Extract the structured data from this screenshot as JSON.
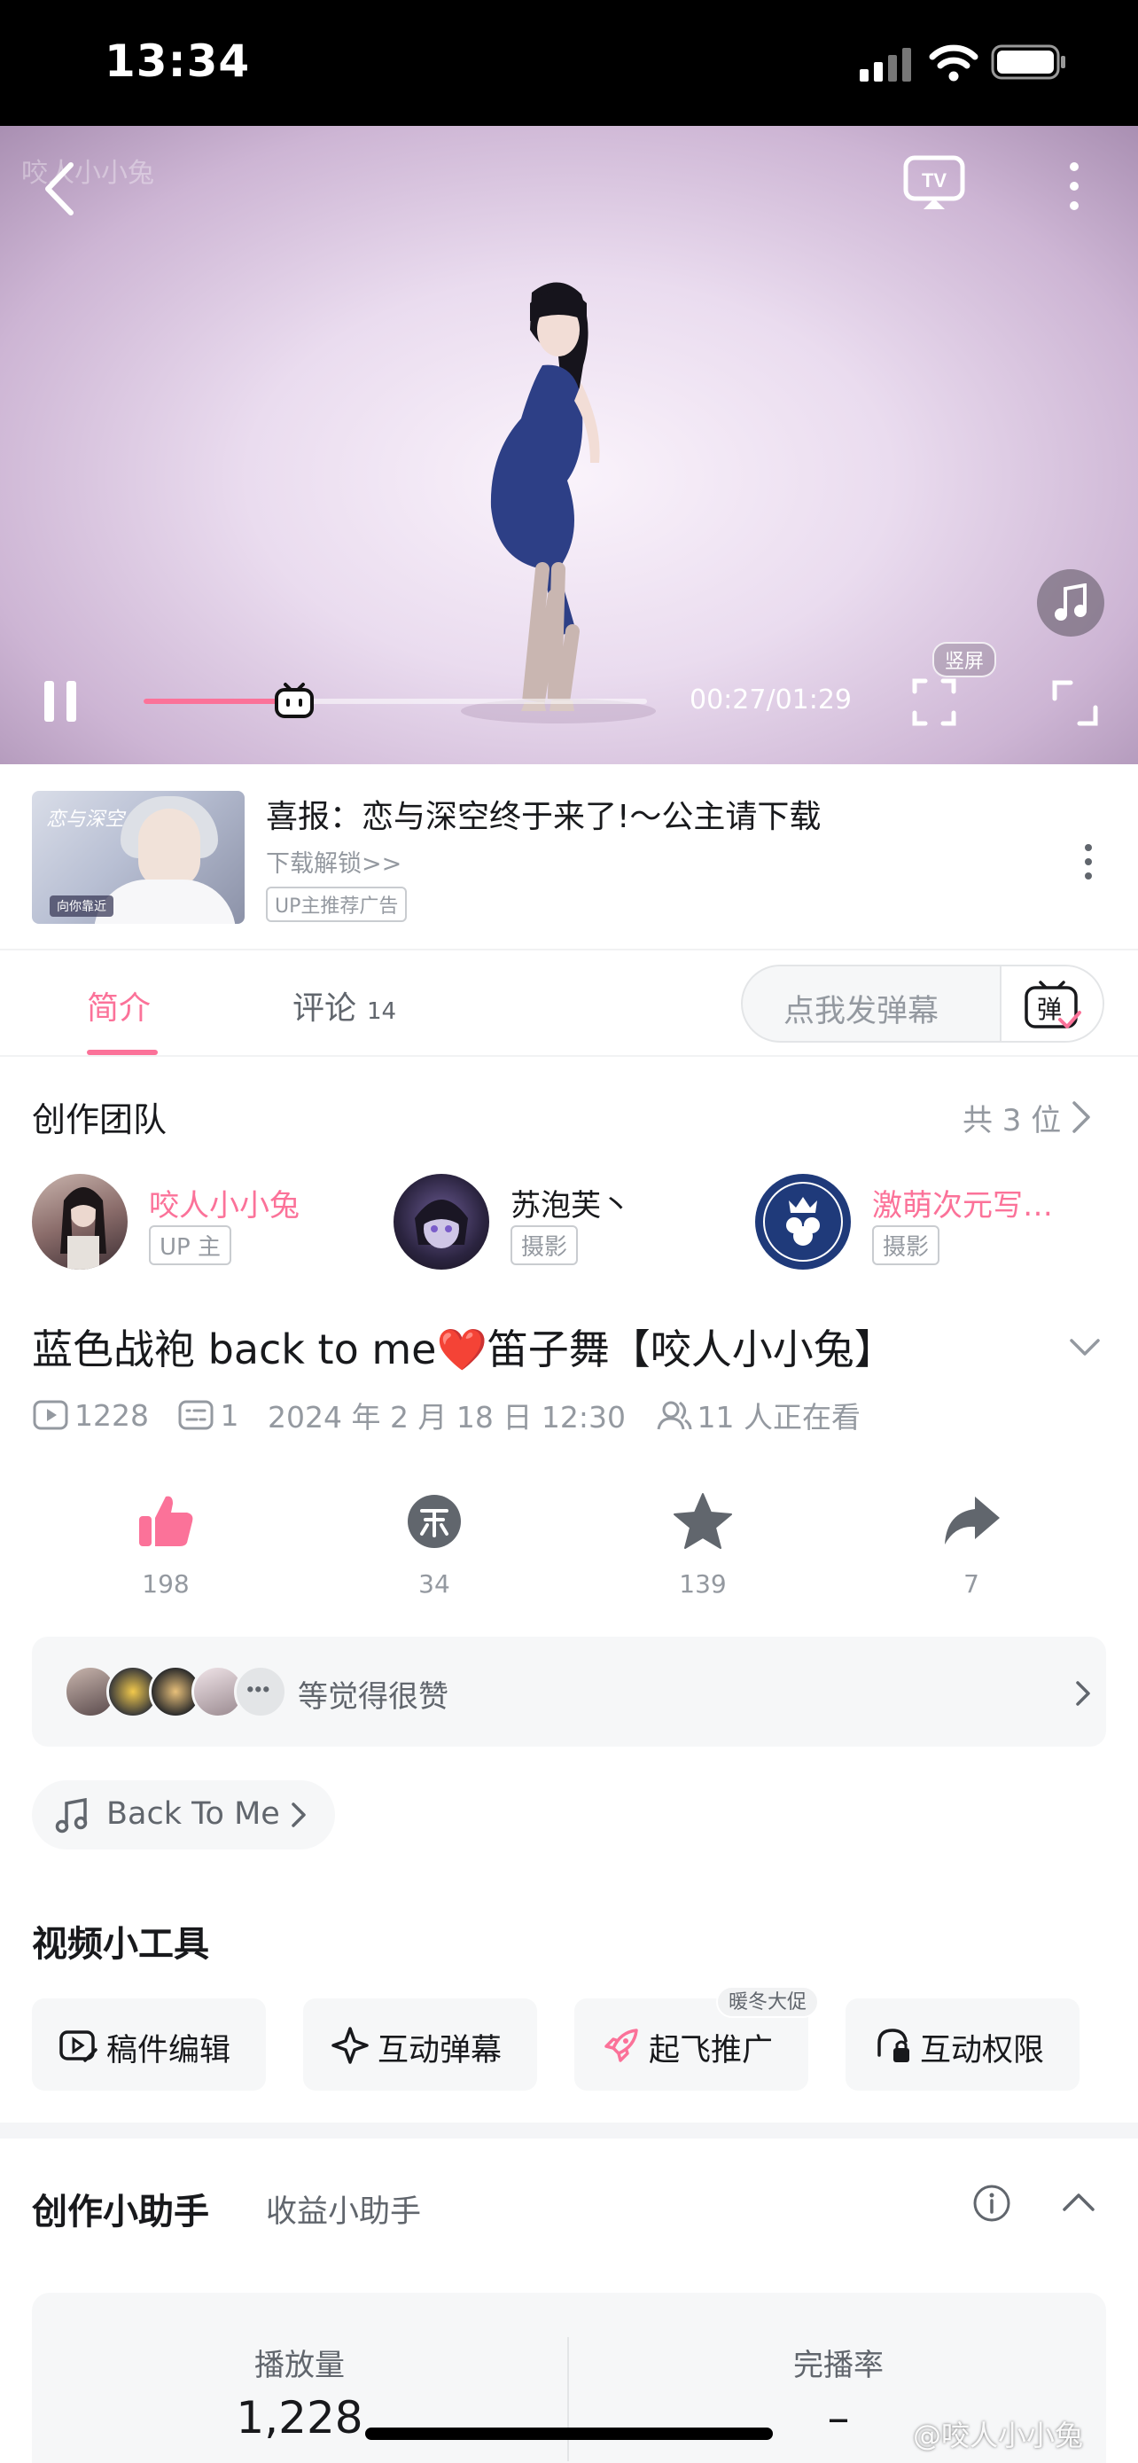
{
  "status_bar": {
    "time": "13:34"
  },
  "player": {
    "watermark": "咬人小小兔",
    "current_time": "00:27",
    "duration": "01:29",
    "time_display": "00:27/01:29",
    "progress_fraction": 0.3,
    "portrait_label": "竖屏",
    "accent_color": "#fb7299"
  },
  "ad": {
    "title": "喜报：恋与深空终于来了!～公主请下载",
    "subtitle": "下载解锁>>",
    "badge": "UP主推荐广告"
  },
  "tabs": [
    {
      "label": "简介",
      "count": ""
    },
    {
      "label": "评论",
      "count": "14"
    }
  ],
  "danmaku": {
    "placeholder": "点我发弹幕",
    "button_icon": "danmaku-toggle-icon"
  },
  "team": {
    "title": "创作团队",
    "count_label": "共 3 位",
    "members": [
      {
        "name": "咬人小小兔",
        "role": "UP 主",
        "name_color": "#fb7299"
      },
      {
        "name": "苏泡芙丶",
        "role": "摄影",
        "name_color": "#18191c"
      },
      {
        "name": "激萌次元写…",
        "role": "摄影",
        "name_color": "#fb7299"
      }
    ]
  },
  "video": {
    "title": "蓝色战袍 back to me❤️笛子舞【咬人小小兔】",
    "views": "1228",
    "danmaku_count": "1",
    "date": "2024 年 2 月 18 日 12:30",
    "watching": "11 人正在看"
  },
  "actions": [
    {
      "name": "like",
      "count": "198"
    },
    {
      "name": "coin",
      "count": "34"
    },
    {
      "name": "favorite",
      "count": "139"
    },
    {
      "name": "share",
      "count": "7"
    }
  ],
  "likers": {
    "text": "等觉得很赞"
  },
  "bgm": {
    "label": "Back To Me"
  },
  "tools": {
    "title": "视频小工具",
    "items": [
      {
        "label": "稿件编辑"
      },
      {
        "label": "互动弹幕"
      },
      {
        "label": "起飞推广",
        "tag": "暖冬大促"
      },
      {
        "label": "互动权限"
      }
    ]
  },
  "assistant": {
    "title": "创作小助手",
    "subtitle": "收益小助手",
    "stats": [
      {
        "label": "播放量",
        "value": "1,228"
      },
      {
        "label": "完播率",
        "value": "–"
      }
    ]
  },
  "watermark_bottom": "@咬人小小兔"
}
